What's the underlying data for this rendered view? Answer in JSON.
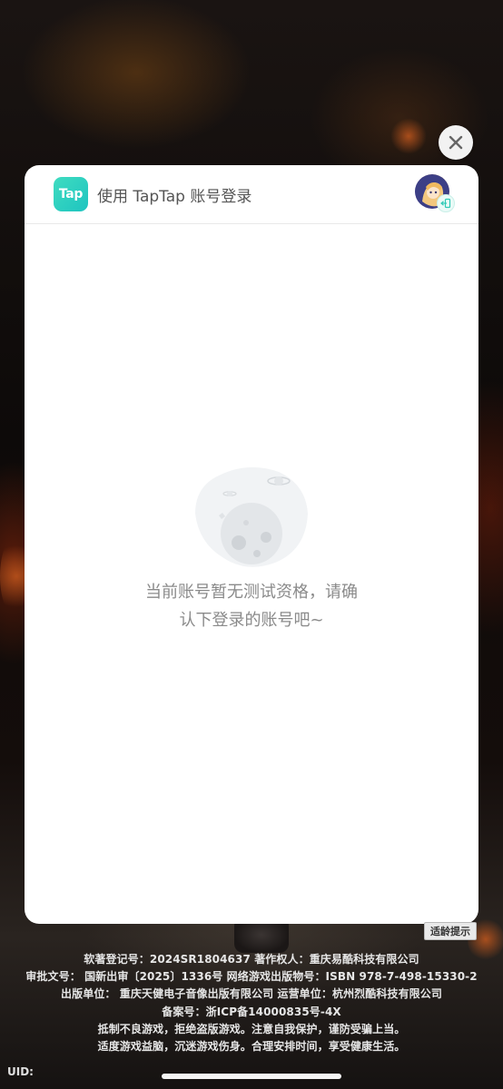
{
  "dialog": {
    "logo_text": "Tap",
    "title": "使用 TapTap 账号登录",
    "empty_message_line1": "当前账号暂无测试资格，请确",
    "empty_message_line2": "认下登录的账号吧~"
  },
  "age_tip": "适龄提示",
  "legal_lines": [
    "软著登记号：2024SR1804637  著作权人：重庆易酷科技有限公司",
    "审批文号：  国新出审〔2025〕1336号  网络游戏出版物号：ISBN 978-7-498-15330-2",
    "出版单位：  重庆天健电子音像出版有限公司  运营单位：杭州烈酷科技有限公司",
    "备案号：浙ICP备14000835号-4X",
    "抵制不良游戏，拒绝盗版游戏。注意自我保护，谨防受骗上当。",
    "适度游戏益脑，沉迷游戏伤身。合理安排时间，享受健康生活。"
  ],
  "uid_label": "UID:",
  "colors": {
    "brand_teal": "#2fd3c0",
    "dialog_bg": "#ffffff",
    "muted_text": "#8a8a8a"
  },
  "icons": {
    "close": "close-icon",
    "switch_account": "switch-account-icon",
    "empty_state": "planet-empty-illustration"
  }
}
